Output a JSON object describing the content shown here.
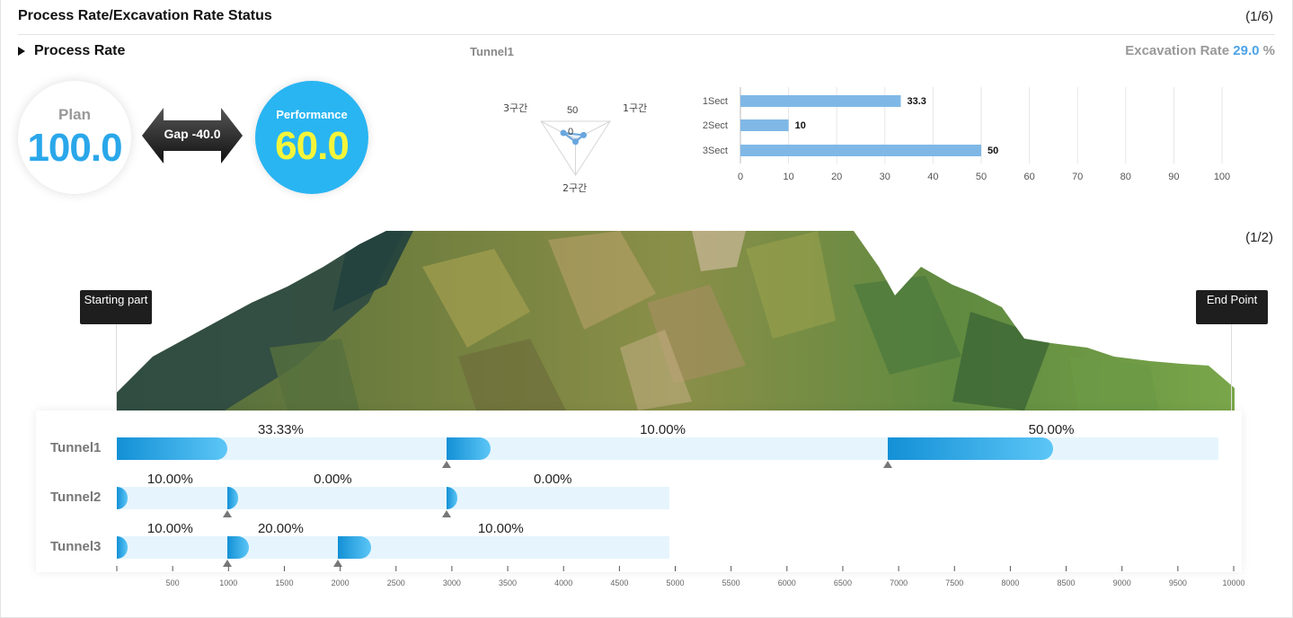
{
  "header": {
    "title": "Process Rate/Excavation Rate Status",
    "pager": "(1/6)"
  },
  "section": {
    "title": "Process Rate",
    "tunnel": "Tunnel1",
    "excavation_label": "Excavation Rate",
    "excavation_value": "29.0",
    "excavation_unit": "%"
  },
  "kpi": {
    "plan_label": "Plan",
    "plan_value": "100.0",
    "gap_text": "Gap -40.0",
    "perf_label": "Performance",
    "perf_value": "60.0"
  },
  "radar": {
    "scale_max": "50",
    "scale_min": "0",
    "axes": [
      "1구간",
      "2구간",
      "3구간"
    ],
    "values": [
      33.3,
      10,
      50
    ]
  },
  "chart_data": {
    "type": "bar",
    "orientation": "horizontal",
    "categories": [
      "1Sect",
      "2Sect",
      "3Sect"
    ],
    "values": [
      33.3,
      10,
      50
    ],
    "value_labels": [
      "33.3",
      "10",
      "50"
    ],
    "xlim": [
      0,
      100
    ],
    "x_ticks": [
      "0",
      "10",
      "20",
      "30",
      "40",
      "50",
      "60",
      "70",
      "80",
      "90",
      "100"
    ],
    "grid": true,
    "color": "#7fb8e6"
  },
  "profile": {
    "pager": "(1/2)",
    "start_label": "Starting part",
    "end_label": "End Point",
    "axis_ticks": [
      "500",
      "1000",
      "1500",
      "2000",
      "2500",
      "3000",
      "3500",
      "4000",
      "4500",
      "5000",
      "5500",
      "6000",
      "6500",
      "7000",
      "7500",
      "8000",
      "8500",
      "9000",
      "9500",
      "10000"
    ]
  },
  "tunnels": [
    {
      "name": "Tunnel1",
      "track_end": 9860,
      "sections": [
        {
          "start": 0,
          "fill_end": 990,
          "pct": "33.33%",
          "label_at": 1480
        },
        {
          "start": 2950,
          "fill_end": 3350,
          "pct": "10.00%",
          "label_at": 4900
        },
        {
          "start": 6900,
          "fill_end": 8380,
          "pct": "50.00%",
          "label_at": 8380
        }
      ],
      "markers": [
        2950,
        6900
      ]
    },
    {
      "name": "Tunnel2",
      "track_end": 4950,
      "sections": [
        {
          "start": 0,
          "fill_end": 100,
          "pct": "10.00%",
          "label_at": 490
        },
        {
          "start": 990,
          "fill_end": 990,
          "pct": "0.00%",
          "label_at": 1980
        },
        {
          "start": 2950,
          "fill_end": 2950,
          "pct": "0.00%",
          "label_at": 3950
        }
      ],
      "markers": [
        990,
        2950
      ]
    },
    {
      "name": "Tunnel3",
      "track_end": 4950,
      "sections": [
        {
          "start": 0,
          "fill_end": 100,
          "pct": "10.00%",
          "label_at": 490
        },
        {
          "start": 990,
          "fill_end": 1180,
          "pct": "20.00%",
          "label_at": 1480
        },
        {
          "start": 1980,
          "fill_end": 2280,
          "pct": "10.00%",
          "label_at": 3450
        }
      ],
      "markers": [
        990,
        1980
      ]
    }
  ]
}
